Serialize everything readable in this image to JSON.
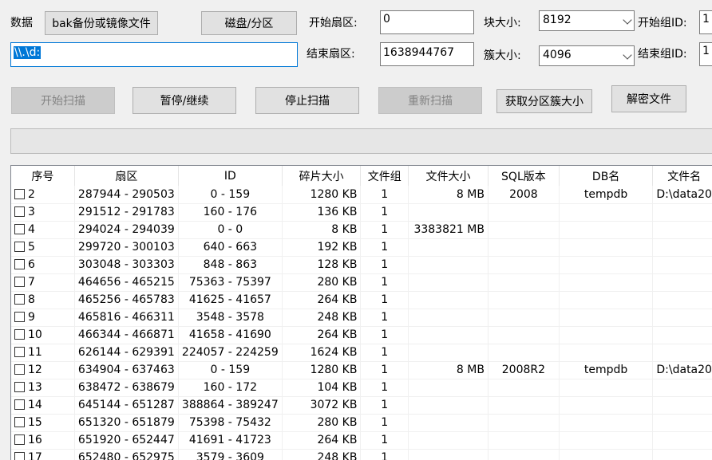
{
  "toolbar": {
    "data_label": "数据",
    "source_button": "bak备份或镜像文件",
    "disk_button": "磁盘/分区",
    "path_value": "\\\\.\\d:",
    "start_sector_label": "开始扇区:",
    "start_sector_value": "0",
    "end_sector_label": "结束扇区:",
    "end_sector_value": "1638944767",
    "block_size_label": "块大小:",
    "block_size_value": "8192",
    "cluster_size_label": "簇大小:",
    "cluster_size_value": "4096",
    "start_group_label": "开始组ID:",
    "start_group_value": "1",
    "end_group_label": "结束组ID:",
    "end_group_value": "1"
  },
  "actions": {
    "start_scan": "开始扫描",
    "pause_resume": "暂停/继续",
    "stop_scan": "停止扫描",
    "rescan": "重新扫描",
    "get_cluster": "获取分区簇大小",
    "decrypt": "解密文件"
  },
  "progress": {
    "fraction": 0
  },
  "table": {
    "columns": [
      "序号",
      "扇区",
      "ID",
      "碎片大小",
      "文件组",
      "文件大小",
      "SQL版本",
      "DB名",
      "文件名"
    ],
    "rows": [
      [
        "2",
        "287944 - 290503",
        "0 - 159",
        "1280 KB",
        "1",
        "8 MB",
        "2008",
        "tempdb",
        "D:\\data20"
      ],
      [
        "3",
        "291512 - 291783",
        "160 - 176",
        "136 KB",
        "1",
        "",
        "",
        "",
        ""
      ],
      [
        "4",
        "294024 - 294039",
        "0 - 0",
        "8 KB",
        "1",
        "3383821 MB",
        "",
        "",
        ""
      ],
      [
        "5",
        "299720 - 300103",
        "640 - 663",
        "192 KB",
        "1",
        "",
        "",
        "",
        ""
      ],
      [
        "6",
        "303048 - 303303",
        "848 - 863",
        "128 KB",
        "1",
        "",
        "",
        "",
        ""
      ],
      [
        "7",
        "464656 - 465215",
        "75363 - 75397",
        "280 KB",
        "1",
        "",
        "",
        "",
        ""
      ],
      [
        "8",
        "465256 - 465783",
        "41625 - 41657",
        "264 KB",
        "1",
        "",
        "",
        "",
        ""
      ],
      [
        "9",
        "465816 - 466311",
        "3548 - 3578",
        "248 KB",
        "1",
        "",
        "",
        "",
        ""
      ],
      [
        "10",
        "466344 - 466871",
        "41658 - 41690",
        "264 KB",
        "1",
        "",
        "",
        "",
        ""
      ],
      [
        "11",
        "626144 - 629391",
        "224057 - 224259",
        "1624 KB",
        "1",
        "",
        "",
        "",
        ""
      ],
      [
        "12",
        "634904 - 637463",
        "0 - 159",
        "1280 KB",
        "1",
        "8 MB",
        "2008R2",
        "tempdb",
        "D:\\data20"
      ],
      [
        "13",
        "638472 - 638679",
        "160 - 172",
        "104 KB",
        "1",
        "",
        "",
        "",
        ""
      ],
      [
        "14",
        "645144 - 651287",
        "388864 - 389247",
        "3072 KB",
        "1",
        "",
        "",
        "",
        ""
      ],
      [
        "15",
        "651320 - 651879",
        "75398 - 75432",
        "280 KB",
        "1",
        "",
        "",
        "",
        ""
      ],
      [
        "16",
        "651920 - 652447",
        "41691 - 41723",
        "264 KB",
        "1",
        "",
        "",
        "",
        ""
      ],
      [
        "17",
        "652480 - 652975",
        "3579 - 3609",
        "248 KB",
        "1",
        "",
        "",
        "",
        ""
      ]
    ]
  }
}
